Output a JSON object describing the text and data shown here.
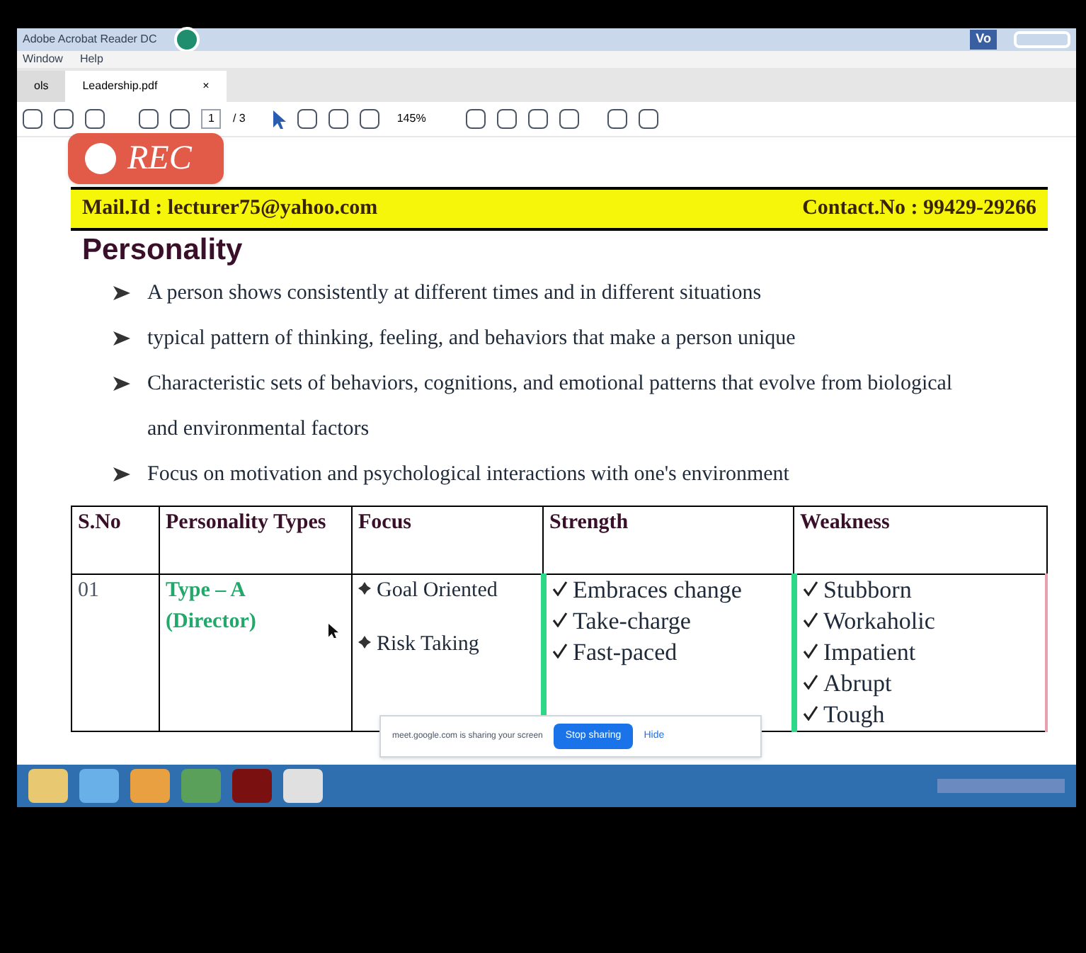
{
  "window": {
    "title": "Adobe Acrobat Reader DC",
    "menu": [
      "Window",
      "Help"
    ],
    "tray_label": "Vo"
  },
  "tabs": [
    {
      "label": "ols",
      "selected": false
    },
    {
      "label": "Leadership.pdf",
      "selected": true,
      "close": "×"
    }
  ],
  "toolbar": {
    "page": "1",
    "page_count": "/ 3",
    "zoom": "145%"
  },
  "recording": {
    "label": "REC"
  },
  "document": {
    "banner_left": "Mail.Id : lecturer75@yahoo.com",
    "banner_right": "Contact.No : 99429-29266",
    "heading": "Personality",
    "bullets": [
      "A person shows consistently at different times and in different situations",
      "typical pattern of thinking, feeling, and behaviors that make a person unique",
      "Characteristic sets of behaviors, cognitions, and emotional patterns that evolve from biological and environmental factors",
      "Focus on motivation and psychological interactions with one's environment"
    ],
    "table": {
      "columns": [
        "S.No",
        "Personality Types",
        "Focus",
        "Strength",
        "Weakness"
      ],
      "rows": [
        {
          "number": "01",
          "type": "Type – A",
          "type_note": "(Director)",
          "focus": [
            "Goal Oriented",
            "Risk Taking"
          ],
          "strengths": [
            "Embraces change",
            "Take-charge",
            "Fast-paced"
          ],
          "weaknesses": [
            "Stubborn",
            "Workaholic",
            "Impatient",
            "Abrupt",
            "Tough"
          ]
        }
      ]
    }
  },
  "share_bar": {
    "message": "meet.google.com is sharing your screen",
    "stop": "Stop sharing",
    "hide": "Hide"
  }
}
